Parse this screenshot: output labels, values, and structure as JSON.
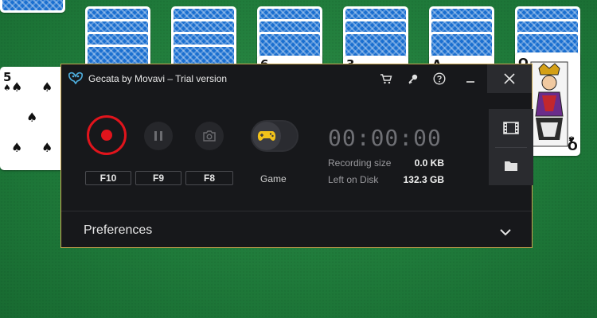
{
  "window": {
    "title": "Gecata by Movavi – Trial version",
    "accent_color": "#e1141c"
  },
  "titlebar_icons": [
    "cart-icon",
    "key-icon",
    "help-icon",
    "minimize-icon",
    "close-icon"
  ],
  "controls": {
    "record_hotkey": "F10",
    "pause_hotkey": "F9",
    "screenshot_hotkey": "F8",
    "game_mode_label": "Game"
  },
  "status": {
    "timer": "00:00:00",
    "recording_size_label": "Recording size",
    "recording_size_value": "0.0 KB",
    "left_on_disk_label": "Left on Disk",
    "left_on_disk_value": "132.3 GB"
  },
  "side_buttons": [
    "video-library-icon",
    "folder-icon"
  ],
  "preferences": {
    "label": "Preferences"
  },
  "background_cards": {
    "visible_ranks": [
      "5",
      "6",
      "3",
      "A",
      "Q",
      "Q"
    ]
  }
}
